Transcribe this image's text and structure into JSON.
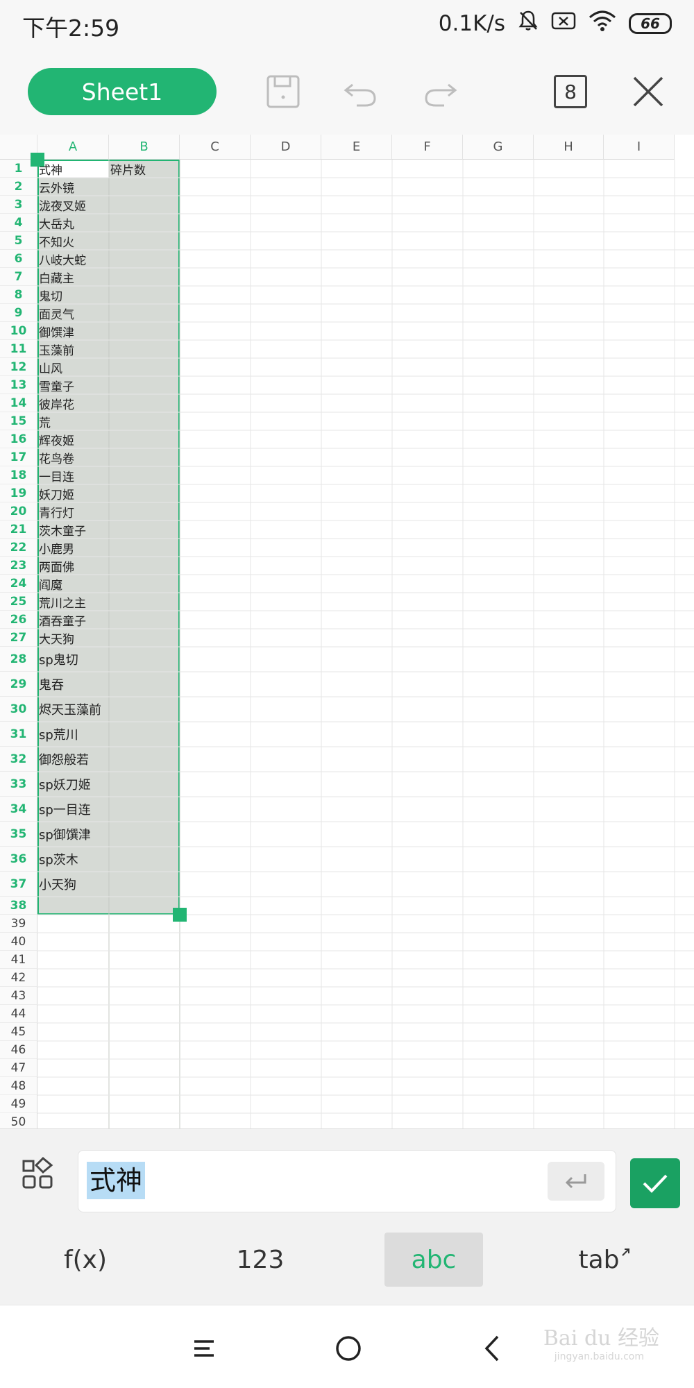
{
  "status_bar": {
    "time": "下午2:59",
    "network_speed": "0.1K/s",
    "battery": "66",
    "icons": [
      "bell-mute-icon",
      "sim-x-icon",
      "wifi-icon",
      "battery-icon"
    ]
  },
  "toolbar": {
    "sheet_label": "Sheet1",
    "sheet_count": "8",
    "icons": [
      "save-icon",
      "undo-icon",
      "redo-icon",
      "close-icon"
    ]
  },
  "sheet": {
    "columns": [
      "A",
      "B",
      "C",
      "D",
      "E",
      "F",
      "G",
      "H",
      "I"
    ],
    "selected_columns": [
      "A",
      "B"
    ],
    "row_count": 50,
    "selected_rows": "1-38",
    "cells": {
      "A1": "式神",
      "B1": "碎片数",
      "A2": "云外镜",
      "A3": "泷夜叉姬",
      "A4": "大岳丸",
      "A5": "不知火",
      "A6": "八岐大蛇",
      "A7": "白藏主",
      "A8": "鬼切",
      "A9": "面灵气",
      "A10": "御馔津",
      "A11": "玉藻前",
      "A12": "山风",
      "A13": "雪童子",
      "A14": "彼岸花",
      "A15": "荒",
      "A16": "辉夜姬",
      "A17": "花鸟卷",
      "A18": "一目连",
      "A19": "妖刀姬",
      "A20": "青行灯",
      "A21": "茨木童子",
      "A22": "小鹿男",
      "A23": "两面佛",
      "A24": "阎魔",
      "A25": "荒川之主",
      "A26": "酒吞童子",
      "A27": "大天狗",
      "A28": "sp鬼切",
      "A29": "鬼吞",
      "A30": "烬天玉藻前",
      "A31": "sp荒川",
      "A32": "御怨般若",
      "A33": "sp妖刀姬",
      "A34": "sp一目连",
      "A35": "sp御馔津",
      "A36": "sp茨木",
      "A37": "小天狗"
    }
  },
  "edit_bar": {
    "value": "式神",
    "icons": [
      "apps-icon",
      "enter-icon",
      "check-icon"
    ]
  },
  "keyboard_modes": [
    {
      "label": "f(x)",
      "active": false
    },
    {
      "label": "123",
      "active": false
    },
    {
      "label": "abc",
      "active": true
    },
    {
      "label": "tab",
      "active": false
    }
  ],
  "nav_bar": {
    "icons": [
      "menu-icon",
      "home-icon",
      "back-icon"
    ],
    "watermark": "Bai du 经验",
    "watermark_sub": "jingyan.baidu.com"
  },
  "colors": {
    "accent": "#22b573",
    "confirm": "#1aa162",
    "selection": "#d6dad5",
    "text_highlight": "#b7dcf5"
  }
}
